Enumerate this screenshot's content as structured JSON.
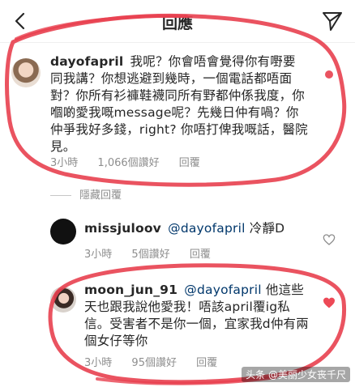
{
  "header": {
    "title": "回應"
  },
  "comments": [
    {
      "username": "dayofapril",
      "text": "我呢？你會唔會覺得你有嘢要同我講？你想逃避到幾時，一個電話都唔面對？你所有衫褲鞋襪同所有野都仲係我度，你嗰啲愛我嘅message呢？先幾日仲有喎？你仲爭我好多錢，right? 你唔打俾我嘅話，醫院見。",
      "time": "3小時",
      "likes": "1,066個讚好",
      "reply_label": "回覆"
    },
    {
      "username": "missjuloov",
      "mention": "@dayofapril",
      "text": " 冷靜D",
      "time": "3小時",
      "likes": "5個讚好",
      "reply_label": "回覆"
    },
    {
      "username": "moon_jun_91",
      "mention": "@dayofapril",
      "text": " 他這些天也跟我說他愛我！唔該april覆ig私信。受害者不是你一個，宜家我d仲有兩個女仔等你",
      "time": "3小時",
      "likes": "95個讚好",
      "reply_label": "回覆"
    }
  ],
  "hidden_replies_label": "隱藏回覆",
  "watermark": "头条 @美丽少女丧千尺",
  "colors": {
    "annotation_red": "#e8404f",
    "liked_heart": "#ed4956",
    "mention_blue": "#00376b",
    "meta_gray": "#8e8e8e"
  },
  "icons": {
    "back": "chevron-left-icon",
    "send": "paper-plane-icon",
    "like": "heart-icon"
  }
}
